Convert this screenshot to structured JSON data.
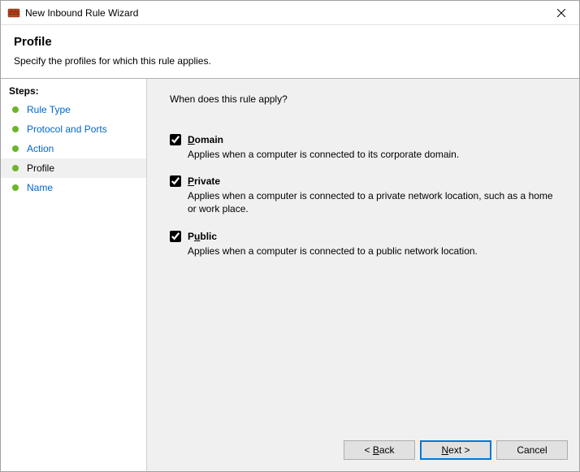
{
  "window": {
    "title": "New Inbound Rule Wizard"
  },
  "header": {
    "title": "Profile",
    "subtitle": "Specify the profiles for which this rule applies."
  },
  "sidebar": {
    "steps_label": "Steps:",
    "items": [
      {
        "label": "Rule Type"
      },
      {
        "label": "Protocol and Ports"
      },
      {
        "label": "Action"
      },
      {
        "label": "Profile"
      },
      {
        "label": "Name"
      }
    ]
  },
  "main": {
    "question": "When does this rule apply?",
    "profiles": [
      {
        "name": "Domain",
        "checked": true,
        "desc": "Applies when a computer is connected to its corporate domain."
      },
      {
        "name": "Private",
        "checked": true,
        "desc": "Applies when a computer is connected to a private network location, such as a home or work place."
      },
      {
        "name": "Public",
        "checked": true,
        "desc": "Applies when a computer is connected to a public network location."
      }
    ]
  },
  "footer": {
    "back": "< Back",
    "next": "Next >",
    "cancel": "Cancel"
  }
}
